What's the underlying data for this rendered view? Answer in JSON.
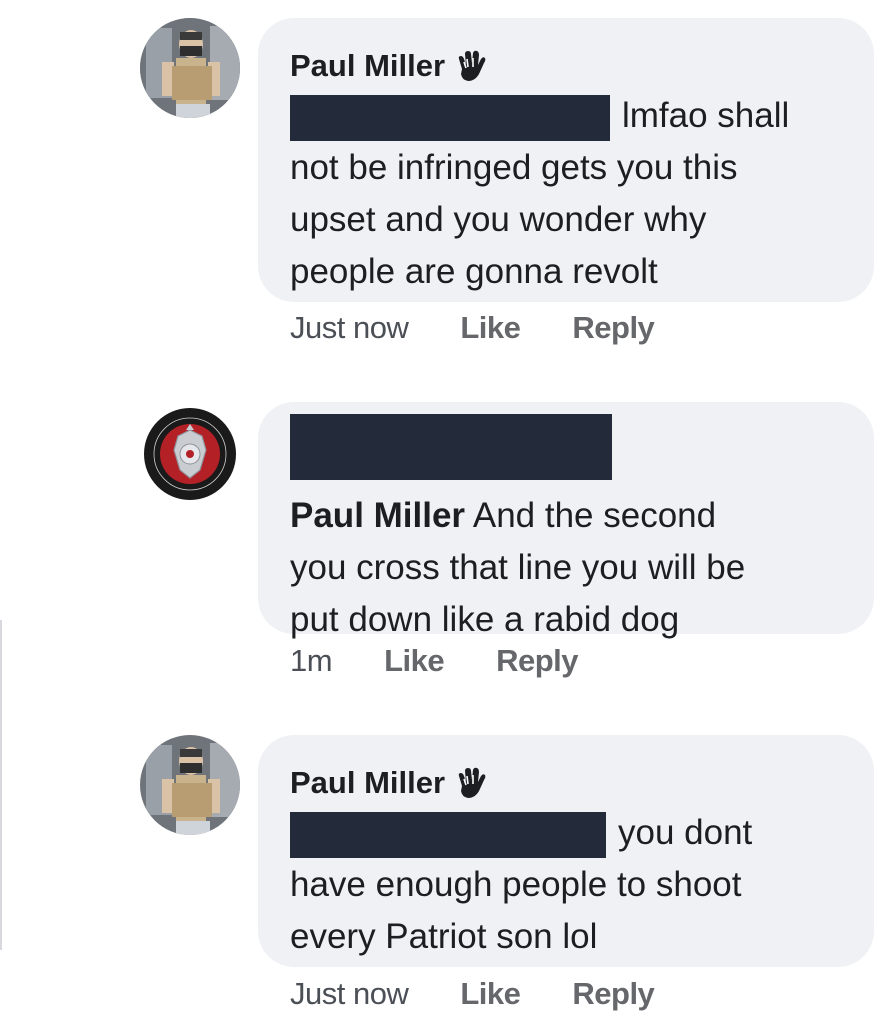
{
  "comments": [
    {
      "author": "Paul Miller",
      "avatar_icon": "masked-man-avatar-icon",
      "badge_icon": "waving-hand-icon",
      "line1": "lmfao shall",
      "line2": "not be infringed gets you this",
      "line3": "upset and you wonder why",
      "line4": "people are gonna revolt",
      "time": "Just now",
      "like": "Like",
      "reply": "Reply"
    },
    {
      "avatar_icon": "fire-department-badge-avatar-icon",
      "mention": "Paul Miller",
      "line1": "And the second",
      "line2": "you cross that line you will be",
      "line3": "put down like a rabid dog",
      "time": "1m",
      "like": "Like",
      "reply": "Reply"
    },
    {
      "author": "Paul Miller",
      "avatar_icon": "masked-man-avatar-icon",
      "badge_icon": "waving-hand-icon",
      "line1": "you dont",
      "line2": "have enough people to shoot",
      "line3": "every Patriot son lol",
      "time": "Just now",
      "like": "Like",
      "reply": "Reply"
    }
  ],
  "colors": {
    "bubble": "#eff1f5",
    "redaction": "#232b3a",
    "meta_text": "#65676b"
  }
}
